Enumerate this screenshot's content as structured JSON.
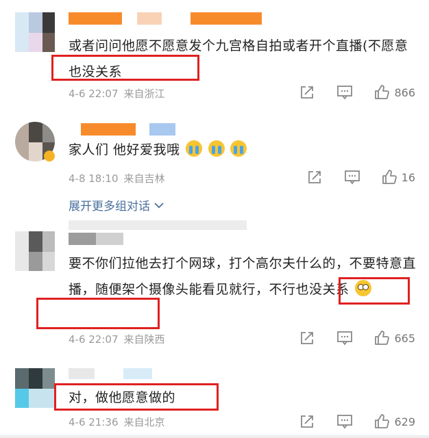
{
  "comments": [
    {
      "text": "或者问问他愿不愿意发个九宫格自拍或者开个直播(不愿意也没关系",
      "date": "4-6 22:07",
      "location": "来自浙江",
      "likes": "866"
    },
    {
      "text": "家人们 他好爱我哦",
      "date": "4-8 18:10",
      "location": "来自吉林",
      "likes": "16"
    },
    {
      "text": "要不你们拉他去打个网球，打个高尔夫什么的，不要特意直播，随便架个摄像头能看见就行，不行也没关系",
      "date": "4-6 22:07",
      "location": "来自陕西",
      "likes": "665"
    },
    {
      "text": "对，做他愿意做的",
      "date": "4-6 21:36",
      "location": "来自北京",
      "likes": "629"
    }
  ],
  "expand_link": "展开更多组对话",
  "colors": {
    "highlight": "#e02020",
    "link": "#4a6f9c",
    "meta": "#9a9a9a"
  },
  "icons": [
    "share-icon",
    "comment-icon",
    "like-icon",
    "chevron-down-icon",
    "crying-emoji-icon",
    "eye-roll-emoji-icon"
  ]
}
